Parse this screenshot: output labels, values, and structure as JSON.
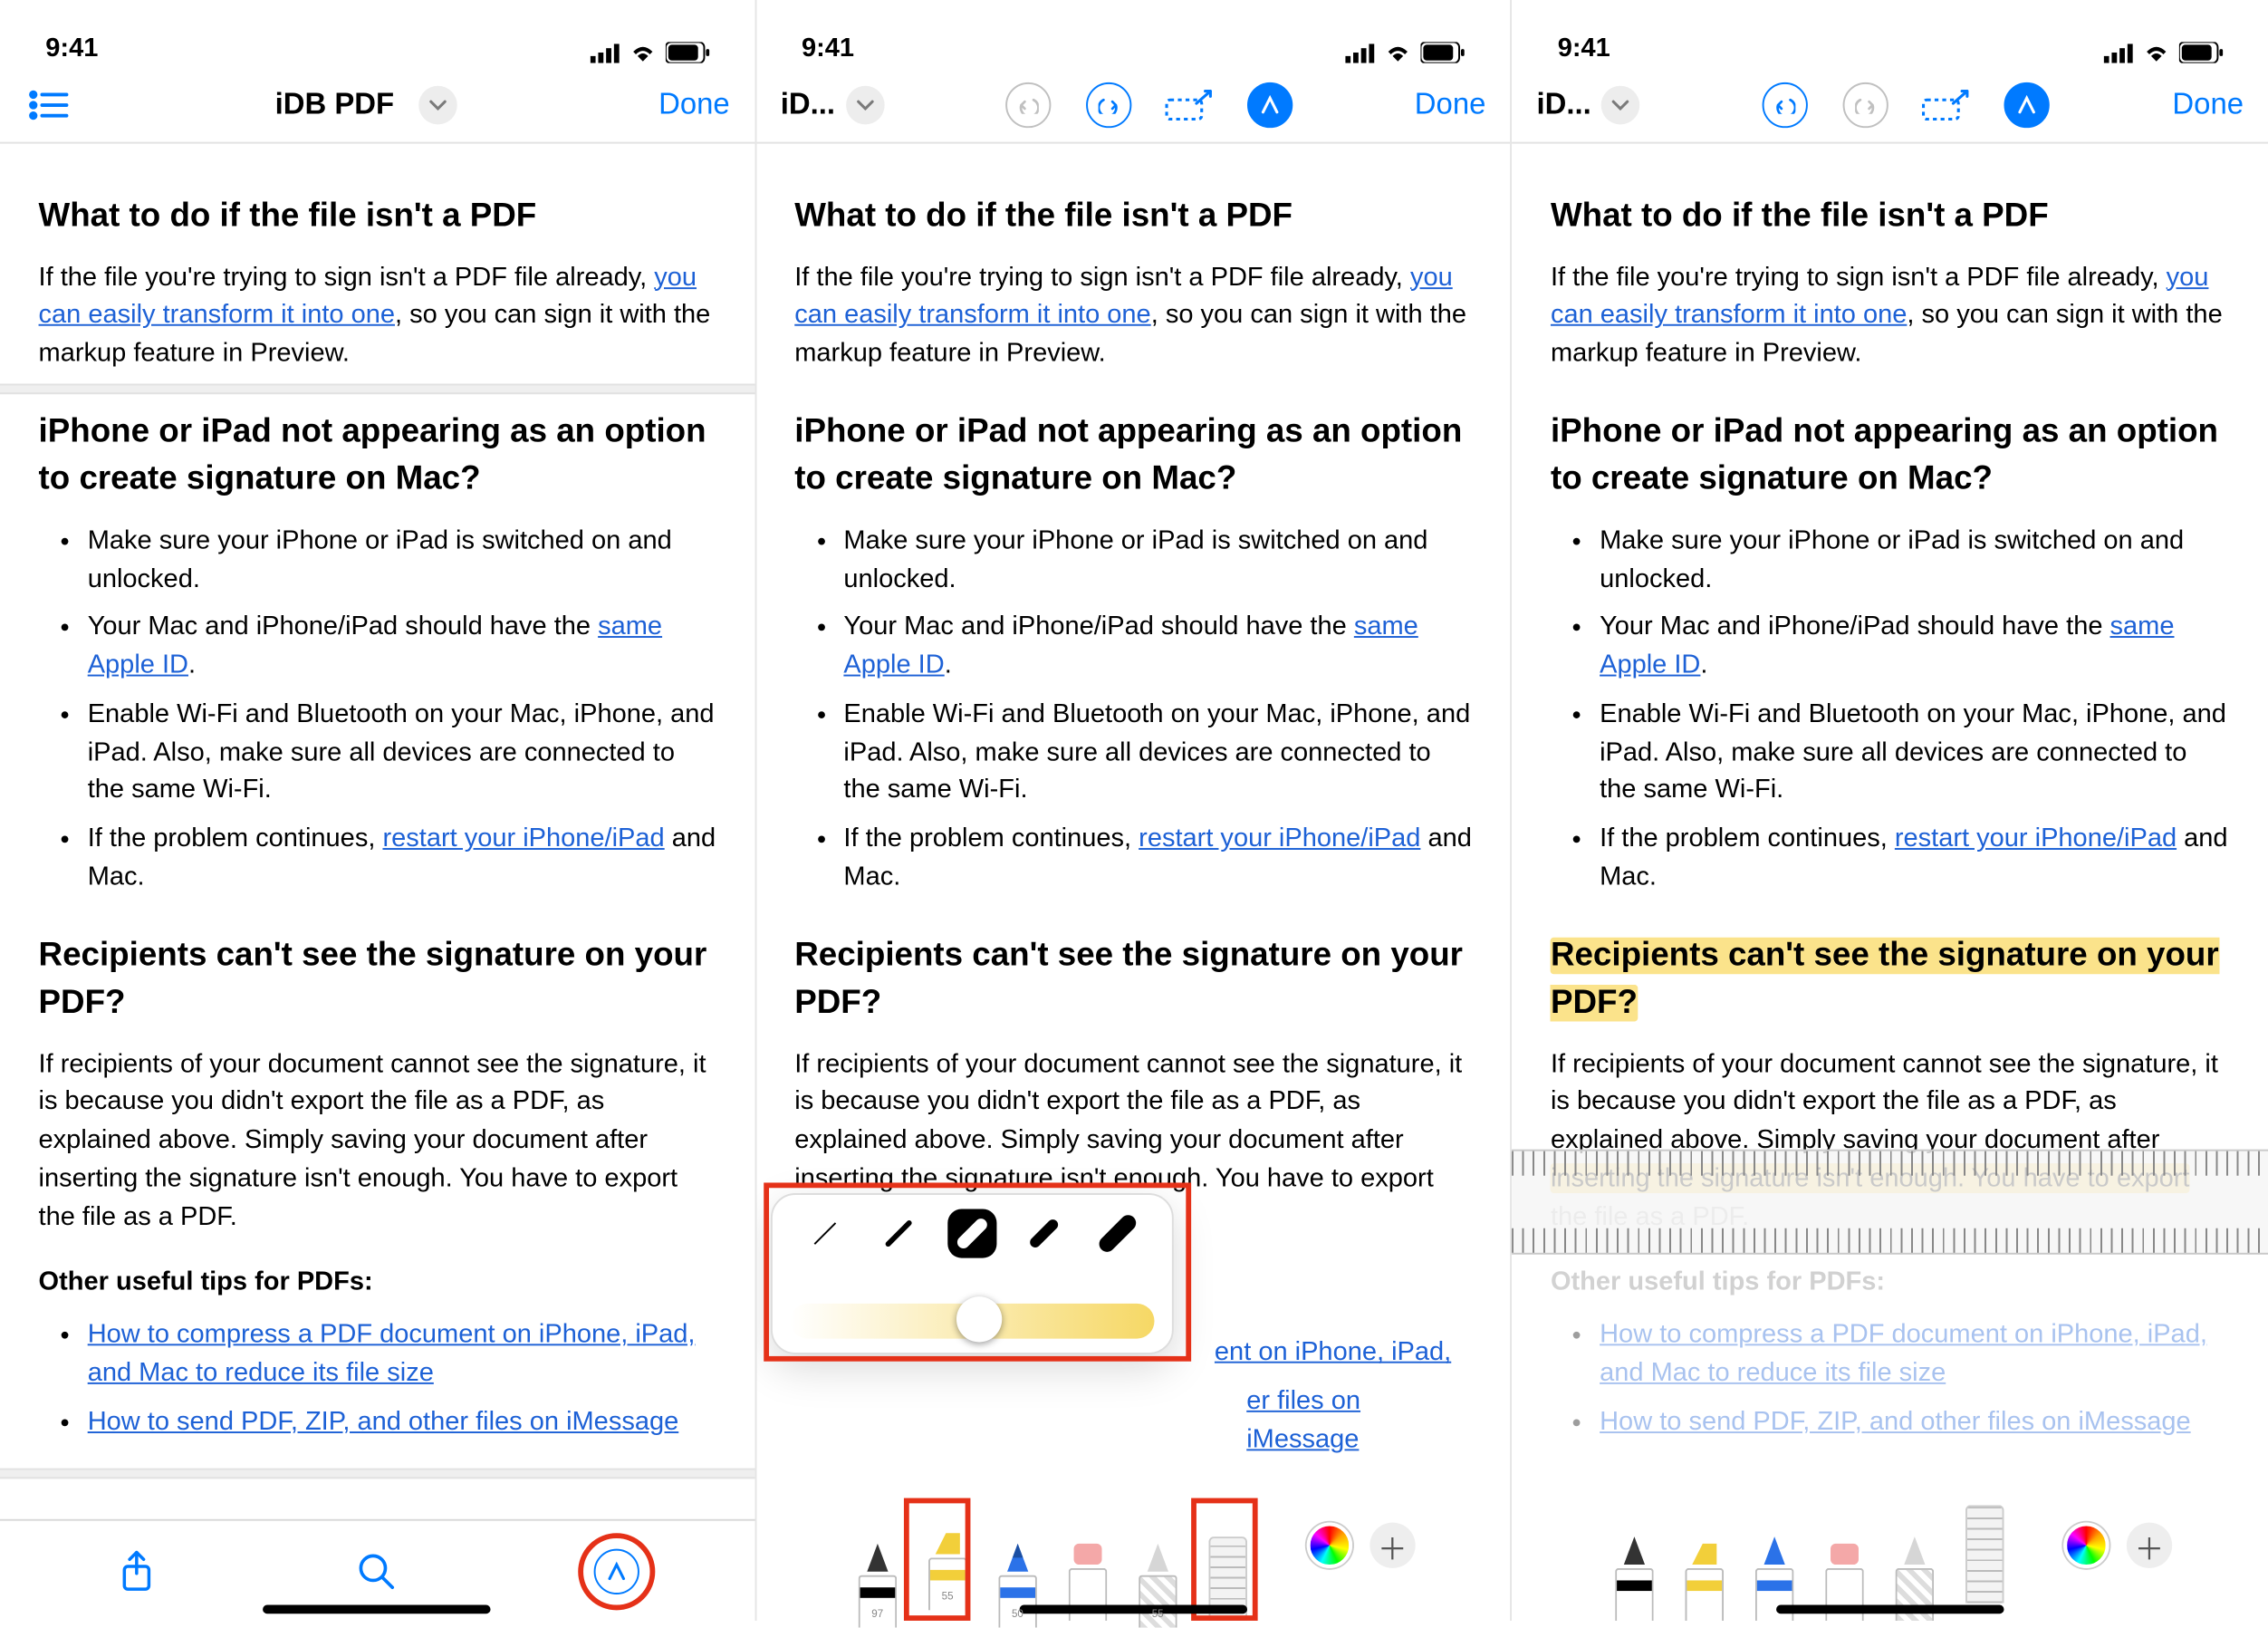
{
  "status": {
    "time": "9:41"
  },
  "nav": {
    "title_full": "iDB PDF",
    "title_trunc": "iD...",
    "done": "Done"
  },
  "doc": {
    "h1": "What to do if the file isn't a PDF",
    "p1a": "If the file you're trying to sign isn't a PDF file already, ",
    "p1link": "you can easily transform it into one",
    "p1b": ", so you can sign it with the markup feature in Preview.",
    "h2": "iPhone or iPad not appearing as an option to create signature on Mac?",
    "li1": "Make sure your iPhone or iPad is switched on and unlocked.",
    "li2a": "Your Mac and iPhone/iPad should have the ",
    "li2link": "same Apple ID",
    "li2b": ".",
    "li3": "Enable Wi-Fi and Bluetooth on your Mac, iPhone, and iPad. Also, make sure all devices are connected to the same Wi-Fi.",
    "li4a": "If the problem continues, ",
    "li4link": "restart your iPhone/iPad",
    "li4b": " and Mac.",
    "h3": "Recipients can't see the signature on your PDF?",
    "p2": "If recipients of your document cannot see the signature, it is because you didn't export the file as a PDF, as explained above. Simply saving your document after inserting the signature isn't enough. You have to export the file as a PDF.",
    "p2_hl_a": "If recipients of your document cannot see the signature, it is because you didn't export the file as a PDF, as explained above. Simply saving your document after ",
    "p2_hl_b": "inserting the signature isn't enough. You have to export",
    "p2_hl_c": " the file as a PDF.",
    "h4": "Other useful tips for PDFs:",
    "ll1": "How to compress a PDF document on iPhone, iPad, and Mac to reduce its file size",
    "ll2": "How to send PDF, ZIP, and other files on iMessage"
  },
  "tools": {
    "pen": "97",
    "hi": "55",
    "pencil": "50",
    "crayon": "55"
  }
}
